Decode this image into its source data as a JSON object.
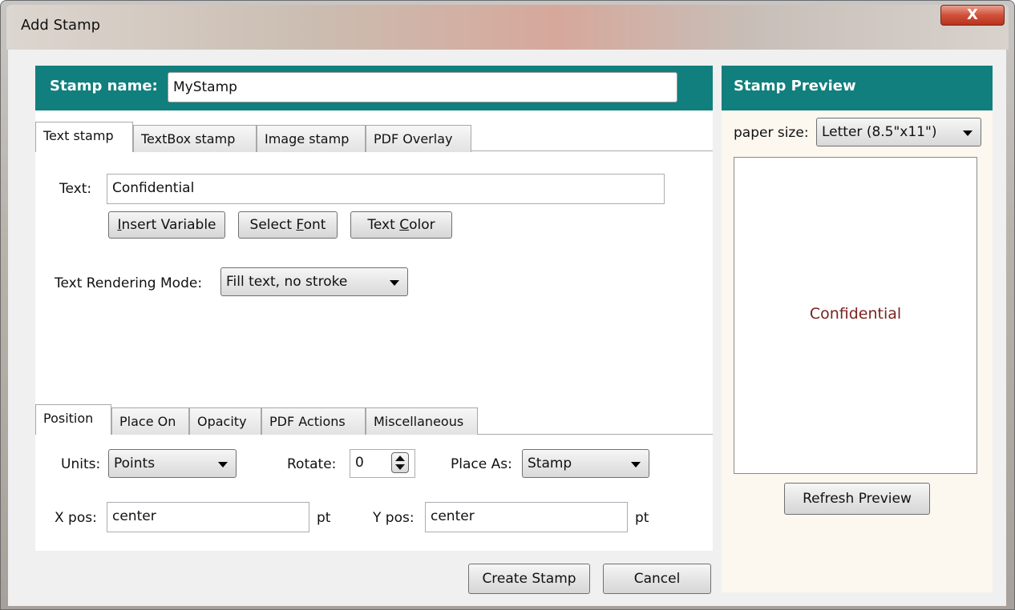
{
  "window": {
    "title": "Add Stamp",
    "close_glyph": "X"
  },
  "stamp_name": {
    "label": "Stamp name:",
    "value": "MyStamp"
  },
  "stamp_type_tabs": [
    "Text stamp",
    "TextBox stamp",
    "Image stamp",
    "PDF Overlay"
  ],
  "text_stamp": {
    "text_label": "Text:",
    "text_value": "Confidential",
    "insert_variable": {
      "pre": "",
      "ul": "I",
      "post": "nsert Variable"
    },
    "select_font": {
      "pre": "Select ",
      "ul": "F",
      "post": "ont"
    },
    "text_color": {
      "pre": "Text ",
      "ul": "C",
      "post": "olor"
    },
    "rendering_label": "Text Rendering Mode:",
    "rendering_value": "Fill text, no stroke"
  },
  "options_tabs": [
    "Position",
    "Place On",
    "Opacity",
    "PDF Actions",
    "Miscellaneous"
  ],
  "position": {
    "units_label": "Units:",
    "units_value": "Points",
    "rotate_label": "Rotate:",
    "rotate_value": "0",
    "place_as_label": "Place As:",
    "place_as_value": "Stamp",
    "xpos_label": "X pos:",
    "xpos_value": "center",
    "xpos_unit": "pt",
    "ypos_label": "Y pos:",
    "ypos_value": "center",
    "ypos_unit": "pt"
  },
  "buttons": {
    "create": "Create Stamp",
    "cancel": "Cancel"
  },
  "preview": {
    "title": "Stamp Preview",
    "paper_label": "paper size:",
    "paper_value": "Letter (8.5\"x11\")",
    "stamp_text": "Confidential",
    "refresh": "Refresh Preview"
  },
  "colors": {
    "header_teal": "#117f7d",
    "preview_text": "#7a2320",
    "preview_panel_bg": "#fcf8ef"
  }
}
